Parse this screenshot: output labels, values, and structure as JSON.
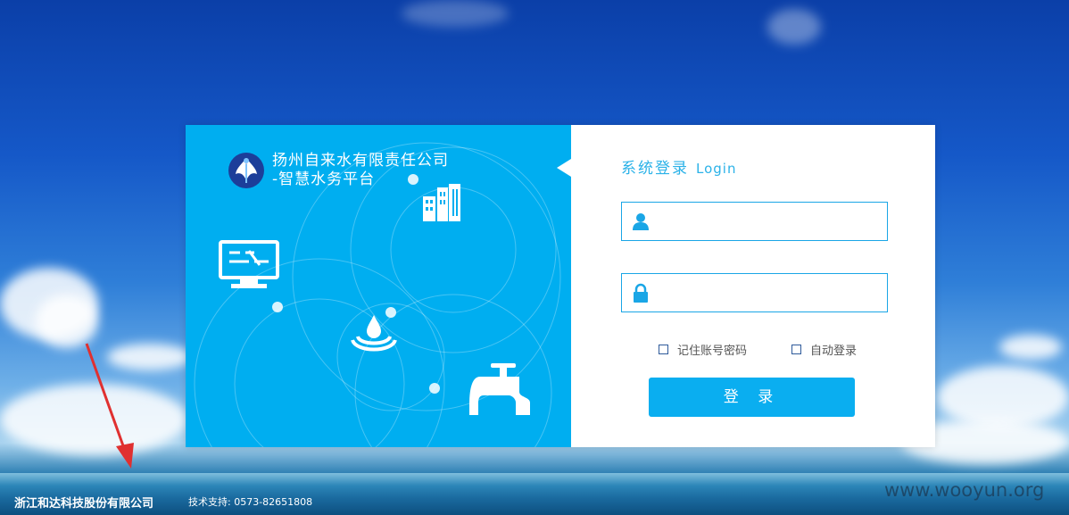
{
  "brand": {
    "company_line1": "扬州自来水有限责任公司",
    "company_line2": "-智慧水务平台"
  },
  "login": {
    "title": "系统登录",
    "title_en": "Login",
    "username_value": "",
    "password_value": "",
    "remember_label": "记住账号密码",
    "auto_login_label": "自动登录",
    "submit_label": "登 录"
  },
  "footer": {
    "company": "浙江和达科技股份有限公司",
    "support": "技术支持: 0573-82651808"
  },
  "watermark": "www.wooyun.org",
  "colors": {
    "accent": "#00aef0",
    "title": "#2bb2e8",
    "arrow": "#e03030"
  },
  "icons": {
    "left_panel": [
      "city-buildings-icon",
      "monitor-icon",
      "water-drop-icon",
      "faucet-icon"
    ],
    "form": [
      "user-icon",
      "lock-icon"
    ],
    "annotation": "red-arrow-icon"
  }
}
